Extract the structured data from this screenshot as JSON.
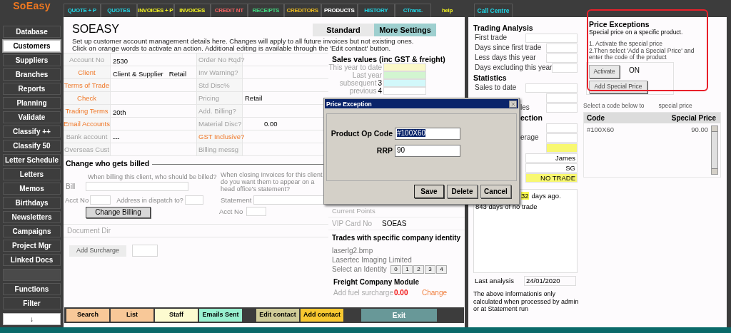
{
  "app": {
    "logo": "SoEasy"
  },
  "sidebar": {
    "items": [
      {
        "kind": "button",
        "label": "Database",
        "selected": false
      },
      {
        "kind": "button",
        "label": "Customers",
        "selected": true
      },
      {
        "kind": "button",
        "label": "Suppliers",
        "selected": false
      },
      {
        "kind": "button",
        "label": "Branches",
        "selected": false
      },
      {
        "kind": "button",
        "label": "Reports",
        "selected": false
      },
      {
        "kind": "button",
        "label": "Planning",
        "selected": false
      },
      {
        "kind": "button",
        "label": "Validate",
        "selected": false
      },
      {
        "kind": "button",
        "label": "Classify ++",
        "selected": false
      },
      {
        "kind": "button",
        "label": "Classify 50",
        "selected": false
      },
      {
        "kind": "button",
        "label": "Letter Schedule",
        "selected": false
      },
      {
        "kind": "button",
        "label": "Letters",
        "selected": false
      },
      {
        "kind": "button",
        "label": "Memos",
        "selected": false
      },
      {
        "kind": "button",
        "label": "Birthdays",
        "selected": false
      },
      {
        "kind": "button",
        "label": "Newsletters",
        "selected": false
      },
      {
        "kind": "button",
        "label": "Campaigns",
        "selected": false
      },
      {
        "kind": "button",
        "label": "Project Mgr",
        "selected": false
      },
      {
        "kind": "button",
        "label": "Linked Docs",
        "selected": false
      },
      {
        "kind": "blank",
        "selected": false
      },
      {
        "kind": "button",
        "label": "Functions",
        "selected": false
      },
      {
        "kind": "button",
        "label": "Filter",
        "selected": false
      },
      {
        "kind": "scroll",
        "label": "↓",
        "selected": false
      }
    ]
  },
  "top_tabs": [
    {
      "kind": "tab",
      "label": "QUOTE + P",
      "color": "#20d4e4"
    },
    {
      "kind": "tab",
      "label": "QUOTES",
      "color": "#20d4e4"
    },
    {
      "kind": "tab",
      "label": "INVOICES + P",
      "color": "#f0f020"
    },
    {
      "kind": "tab",
      "label": "INVOICES",
      "color": "#f0f020"
    },
    {
      "kind": "tab",
      "label": "CREDIT NT",
      "color": "#f06060"
    },
    {
      "kind": "tab",
      "label": "RECEIPTS",
      "color": "#40d880"
    },
    {
      "kind": "tab",
      "label": "CREDITORS",
      "color": "#e8b820"
    },
    {
      "kind": "tab",
      "label": "PRODUCTS",
      "color": "#ffffff"
    },
    {
      "kind": "tab",
      "label": "HISTORY",
      "color": "#20d4e4"
    },
    {
      "kind": "tab",
      "label": "CTrans.",
      "color": "#20d4e4"
    },
    {
      "kind": "link",
      "label": "help",
      "color": "#f0f020"
    }
  ],
  "call_centre_tab": {
    "label": "Call Centre",
    "color": "#20d4e4"
  },
  "customer": {
    "title": "SOEASY",
    "view_tabs": [
      {
        "label": "Standard",
        "selected": false
      },
      {
        "label": "More Settings",
        "selected": true
      }
    ],
    "description": [
      "Set up customer account management details here. Changes will apply to all future invoices but not existing ones.",
      "Click on orange words to activate an action. Additional editing is available through the 'Edit contact' button."
    ],
    "fields": [
      {
        "label": "Account No",
        "action": false,
        "value": "2530",
        "label2": "Order No Rqd?",
        "action2": false
      },
      {
        "label": "Client",
        "action": true,
        "value": "Client & Supplier",
        "value_b": "Retail",
        "label2": "Inv Warning?",
        "action2": false
      },
      {
        "label": "Terms of Trade",
        "action": true,
        "label2": "Std Disc%",
        "action2": false
      },
      {
        "label": "Check",
        "action": true,
        "label2": "Pricing",
        "action2": false,
        "value2": "Retail"
      },
      {
        "label": "Trading Terms",
        "action": true,
        "value": "20th",
        "label2": "Add. Billing?",
        "action2": false
      },
      {
        "label": "Email Accounts",
        "action": true,
        "label2": "Material Disc?",
        "action2": false,
        "value2": "0.00"
      },
      {
        "label": "Bank account",
        "action": false,
        "value": "---",
        "label2": "GST Inclusive?",
        "action2": true
      },
      {
        "label": "Overseas Cust",
        "action": false,
        "label2": "Billing messg",
        "action2": false
      }
    ]
  },
  "billing": {
    "heading": "Change who gets billed",
    "bill_hint": "When billing this client, who should be billed?",
    "statement_hint": "When closing Invoices for this client do you want them to appear on a head office's statement?",
    "bill_label": "Bill",
    "acct_label": "Acct No",
    "dispatch_label": "Address in dispatch to?",
    "statement_label": "Statement",
    "change_button": "Change Billing",
    "acct_label_2": "Acct No"
  },
  "document_dir": "Document Dir",
  "surcharge_button": "Add Surcharge",
  "sales": {
    "heading": "Sales values (inc GST & freight)",
    "rows": [
      {
        "label": "This year to date",
        "color": "#fbf8c8"
      },
      {
        "label": "Last year",
        "color": "#d2f5d0"
      },
      {
        "label": "subsequent",
        "number": "3",
        "color": "#d2f8fa"
      },
      {
        "label": "previous",
        "number": "4",
        "color": "#ffffff"
      }
    ],
    "current_points": "Current Points",
    "vip_label": "VIP Card No",
    "vip_value": "SOEAS",
    "identity_heading": "Trades with specific company identity",
    "identity_file": "laserlg2.bmp",
    "identity_name": "Lasertec Imaging Limited",
    "identity_label": "Select an Identity",
    "identities": [
      {
        "label": "0",
        "selected": false
      },
      {
        "label": "1",
        "selected": false
      },
      {
        "label": "2",
        "selected": false
      },
      {
        "label": "3",
        "selected": false
      },
      {
        "label": "4",
        "selected": false
      }
    ],
    "freight_heading": "Freight Company Module",
    "fuel_label": "Add fuel surcharge",
    "fuel_value": "0.00",
    "fuel_action": "Change"
  },
  "toolbar": [
    {
      "label": "Search",
      "color": "#f8c898"
    },
    {
      "label": "List",
      "color": "#f8c898"
    },
    {
      "label": "Staff",
      "color": "#fdfbd0"
    },
    {
      "label": "Emails Sent",
      "color": "#98f0d0"
    },
    {
      "label": "Edit contact",
      "color": "#d0cc98"
    },
    {
      "label": "Add contact",
      "color": "#f8c830"
    },
    {
      "label": "Exit",
      "color": "#689898"
    }
  ],
  "trading": {
    "rows": [
      {
        "kind": "heading",
        "label": "Trading Analysis"
      },
      {
        "kind": "wide_field",
        "label": "First trade"
      },
      {
        "kind": "field",
        "label": "Days since first trade"
      },
      {
        "kind": "field",
        "label": "Less days this year"
      },
      {
        "kind": "field",
        "label": "Days excluding this year"
      },
      {
        "kind": "heading",
        "label": "Statistics"
      },
      {
        "kind": "wide_field",
        "label": "Sales to date"
      },
      {
        "kind": "field"
      },
      {
        "kind": "field",
        "fragment": "les"
      },
      {
        "kind": "heading",
        "fragment": "ection"
      },
      {
        "kind": "field"
      },
      {
        "kind": "field",
        "fragment": "erage"
      },
      {
        "kind": "field",
        "highlighted": true
      },
      {
        "kind": "wide_field",
        "value": "James"
      },
      {
        "kind": "wide_field",
        "value": "SG"
      },
      {
        "kind": "wide_field",
        "value": "NO TRADE",
        "highlighted": true
      }
    ],
    "notes_first": "32",
    "notes_first_rest": "days ago.",
    "notes_second": "843 days of no trade",
    "last_analysis_label": "Last analysis",
    "last_analysis": "24/01/2020",
    "footer": "The above informationis only calculated when processed by admin or at Statement run"
  },
  "price_exceptions": {
    "title": "Price Exceptions",
    "subtitle": "Special price on a specific product.",
    "steps": [
      "1. Activate the special price",
      "2.Then select 'Add a Special Price' and enter the code of the product"
    ],
    "activate_button": "Activate",
    "status": "ON",
    "add_button": "Add Special Price",
    "hint_start": "Select a code below to",
    "hint_end": "special price",
    "columns": [
      "Code",
      "Special Price"
    ],
    "rows": [
      {
        "code": "#100X60",
        "price": "90.00"
      }
    ]
  },
  "dialog": {
    "title": "Price Exception",
    "code_label": "Product Op Code",
    "code_value": "#100X60",
    "code_value_selected": true,
    "rrp_label": "RRP",
    "rrp_value": "90",
    "buttons": [
      "Save",
      "Delete",
      "Cancel"
    ]
  }
}
